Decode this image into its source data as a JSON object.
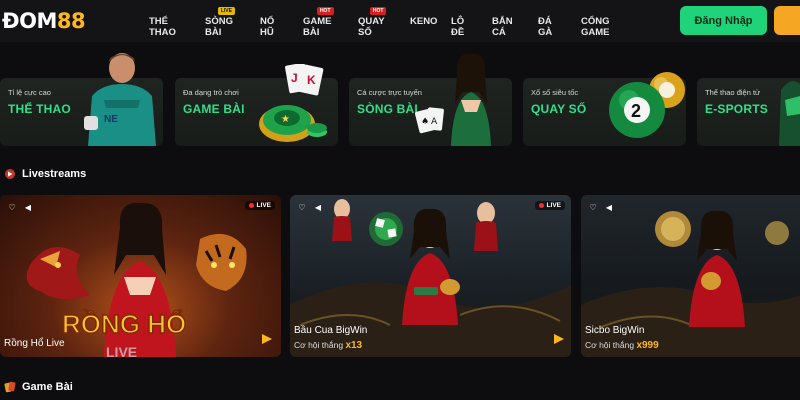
{
  "logo": {
    "part1": "ĐOM",
    "part2": "88"
  },
  "nav": [
    {
      "label": "THỂ THAO",
      "badge": ""
    },
    {
      "label": "SÒNG BÀI",
      "badge": "LIVE"
    },
    {
      "label": "NỔ HŨ",
      "badge": ""
    },
    {
      "label": "GAME BÀI",
      "badge": "HOT"
    },
    {
      "label": "QUAY SỐ",
      "badge": "HOT"
    },
    {
      "label": "KENO",
      "badge": ""
    },
    {
      "label": "LÔ ĐỀ",
      "badge": ""
    },
    {
      "label": "BẮN CÁ",
      "badge": ""
    },
    {
      "label": "ĐÁ GÀ",
      "badge": ""
    },
    {
      "label": "CỔNG GAME",
      "badge": ""
    }
  ],
  "auth": {
    "login_label": "Đăng Nhập"
  },
  "categories": [
    {
      "subtitle": "Tỉ lệ cực cao",
      "title": "THỂ THAO"
    },
    {
      "subtitle": "Đa dạng trò chơi",
      "title": "GAME BÀI"
    },
    {
      "subtitle": "Cá cược trực tuyến",
      "title": "SÒNG BÀI"
    },
    {
      "subtitle": "Xổ số siêu tốc",
      "title": "QUAY SỐ"
    },
    {
      "subtitle": "Thể thao điện tử",
      "title": "E-SPORTS"
    }
  ],
  "sections": {
    "livestreams": "Livestreams",
    "game_bai": "Game Bài"
  },
  "livestreams": [
    {
      "name": "Rồng Hổ Live",
      "odds_label": "",
      "odds_value": "",
      "live": "LIVE",
      "banner": "RỒNG HỔ",
      "banner_sub": "LIVE"
    },
    {
      "name": "Bầu Cua BigWin",
      "odds_label": "Cơ hội thắng",
      "odds_value": "x13",
      "live": "LIVE"
    },
    {
      "name": "Sicbo BigWin",
      "odds_label": "Cơ hội thắng",
      "odds_value": "x999",
      "live": ""
    }
  ],
  "icons": {
    "heart": "heart-icon",
    "sound": "speaker-icon",
    "play": "play-icon"
  },
  "colors": {
    "accent_green": "#1fd37a",
    "accent_gold": "#ffb81c",
    "bg": "#0d0d0f"
  }
}
